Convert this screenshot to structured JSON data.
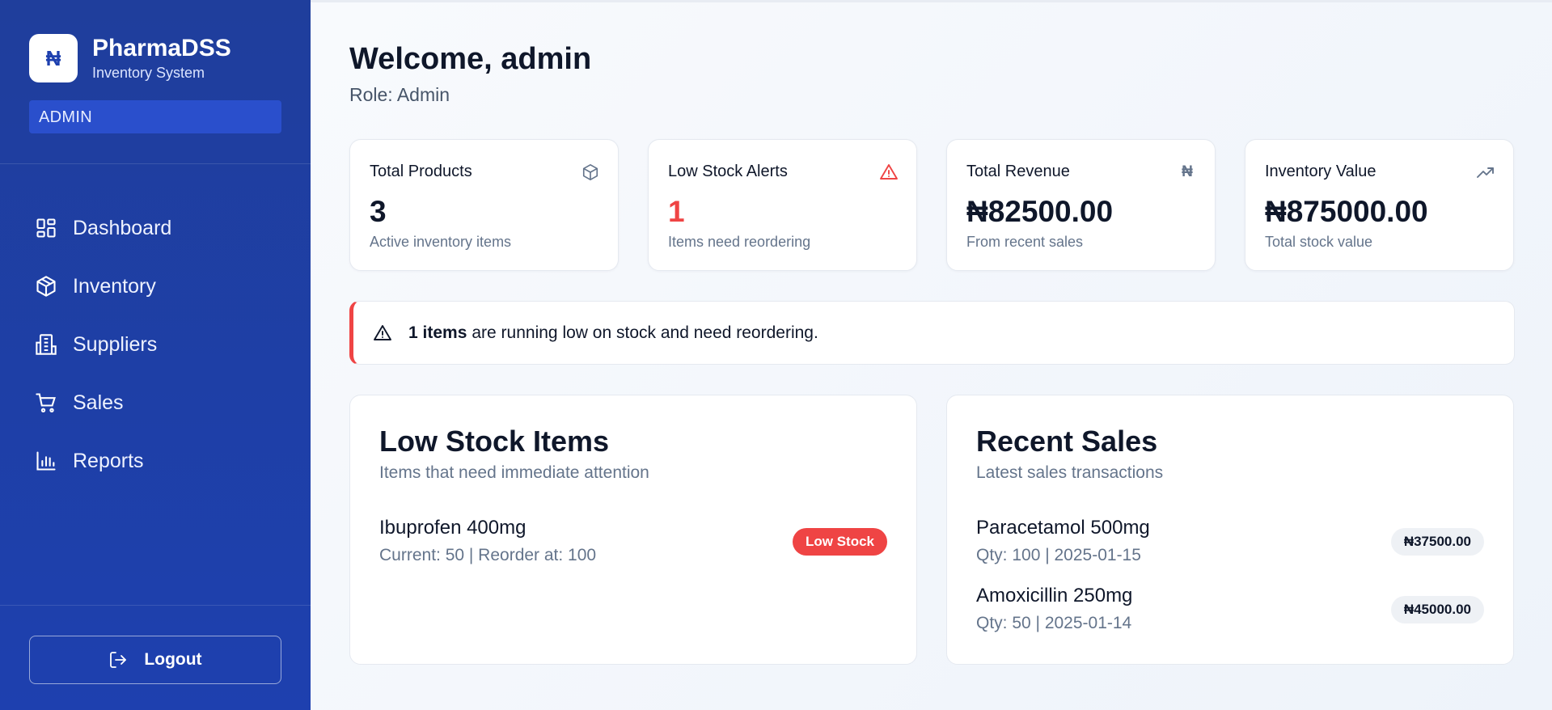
{
  "app": {
    "logo_glyph": "₦",
    "title": "PharmaDSS",
    "subtitle": "Inventory System",
    "role_badge": "ADMIN"
  },
  "nav": {
    "items": [
      {
        "label": "Dashboard",
        "icon": "dashboard-icon"
      },
      {
        "label": "Inventory",
        "icon": "package-icon"
      },
      {
        "label": "Suppliers",
        "icon": "building-icon"
      },
      {
        "label": "Sales",
        "icon": "cart-icon"
      },
      {
        "label": "Reports",
        "icon": "bar-chart-icon"
      }
    ],
    "logout_label": "Logout"
  },
  "header": {
    "welcome": "Welcome, admin",
    "role": "Role: Admin"
  },
  "stats": [
    {
      "label": "Total Products",
      "value": "3",
      "sub": "Active inventory items",
      "icon": "package-icon"
    },
    {
      "label": "Low Stock Alerts",
      "value": "1",
      "sub": "Items need reordering",
      "icon": "warning-icon"
    },
    {
      "label": "Total Revenue",
      "value": "₦82500.00",
      "sub": "From recent sales",
      "icon": "naira-icon"
    },
    {
      "label": "Inventory Value",
      "value": "₦875000.00",
      "sub": "Total stock value",
      "icon": "trending-up-icon"
    }
  ],
  "alert": {
    "count_text": "1 items",
    "message": "are running low on stock and need reordering."
  },
  "low_stock": {
    "title": "Low Stock Items",
    "subtitle": "Items that need immediate attention",
    "items": [
      {
        "name": "Ibuprofen 400mg",
        "meta": "Current: 50 | Reorder at: 100",
        "badge": "Low Stock"
      }
    ]
  },
  "recent_sales": {
    "title": "Recent Sales",
    "subtitle": "Latest sales transactions",
    "items": [
      {
        "name": "Paracetamol 500mg",
        "meta": "Qty: 100 | 2025-01-15",
        "amount": "₦37500.00"
      },
      {
        "name": "Amoxicillin 250mg",
        "meta": "Qty: 50 | 2025-01-14",
        "amount": "₦45000.00"
      }
    ]
  },
  "colors": {
    "sidebar": "#1e40af",
    "danger": "#ef4444",
    "text": "#0f172a",
    "muted": "#64748b"
  }
}
